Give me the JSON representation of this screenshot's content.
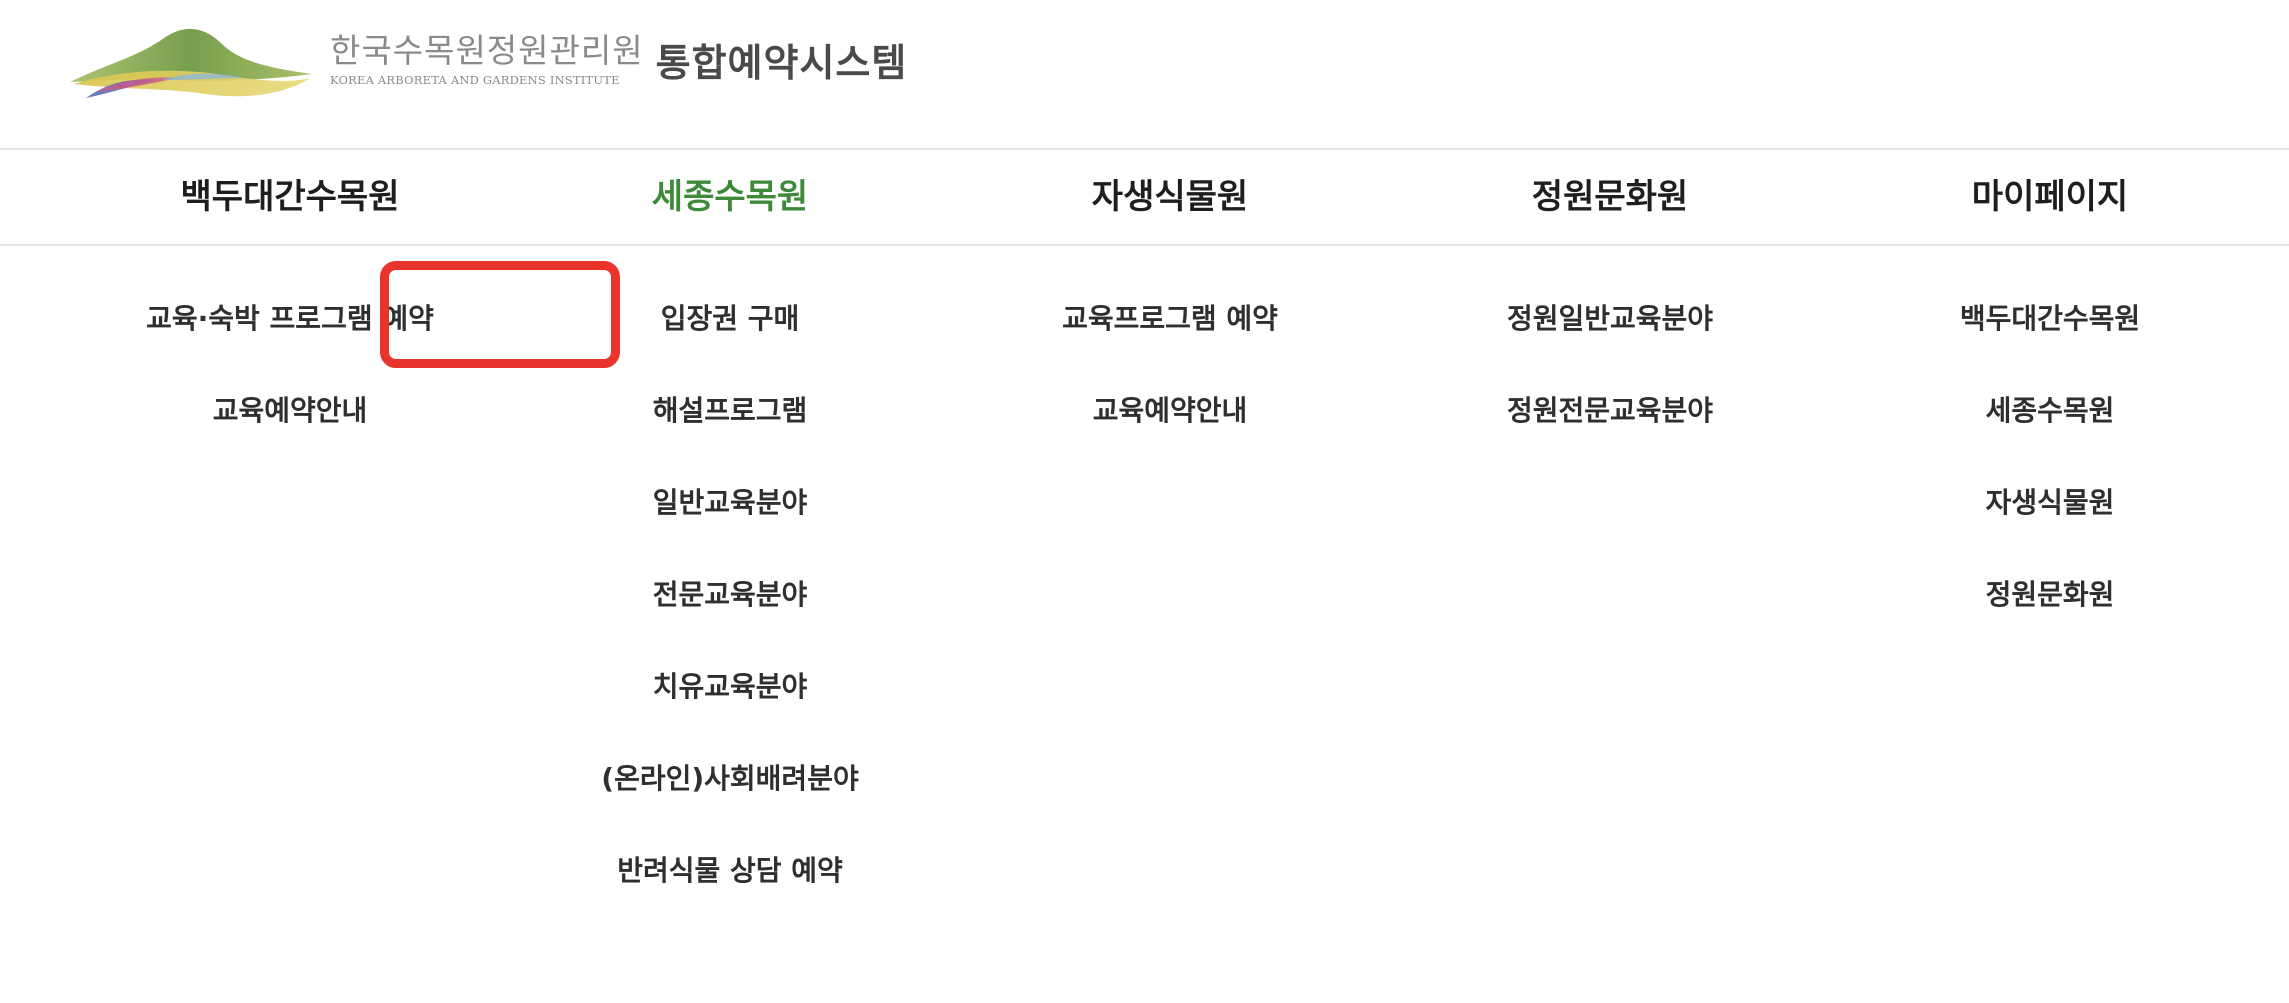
{
  "header": {
    "org_name_kr": "한국수목원정원관리원",
    "org_name_en": "KOREA ARBORETA AND GARDENS INSTITUTE",
    "system_name": "통합예약시스템"
  },
  "colors": {
    "active_nav": "#3f8a3a",
    "highlight_border": "#e8342a"
  },
  "nav": [
    {
      "label": "백두대간수목원",
      "active": false,
      "items": [
        "교육·숙박 프로그램 예약",
        "교육예약안내"
      ]
    },
    {
      "label": "세종수목원",
      "active": true,
      "items": [
        "입장권 구매",
        "해설프로그램",
        "일반교육분야",
        "전문교육분야",
        "치유교육분야",
        "(온라인)사회배려분야",
        "반려식물 상담 예약"
      ],
      "highlighted_item": "입장권 구매"
    },
    {
      "label": "자생식물원",
      "active": false,
      "items": [
        "교육프로그램 예약",
        "교육예약안내"
      ]
    },
    {
      "label": "정원문화원",
      "active": false,
      "items": [
        "정원일반교육분야",
        "정원전문교육분야"
      ]
    },
    {
      "label": "마이페이지",
      "active": false,
      "items": [
        "백두대간수목원",
        "세종수목원",
        "자생식물원",
        "정원문화원"
      ]
    }
  ]
}
